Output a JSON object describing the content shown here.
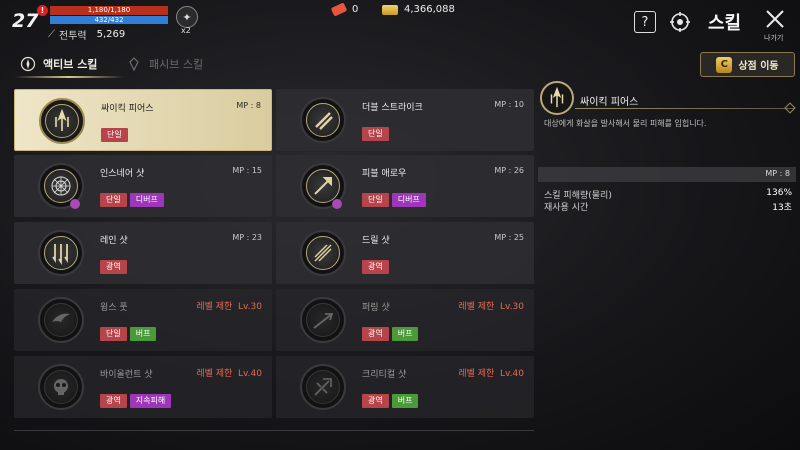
{
  "player": {
    "level": "27",
    "hp_text": "1,180/1,180",
    "mp_text": "432/432",
    "power_label": "전투력",
    "power_value": "5,269",
    "buff_count": "x2"
  },
  "currency": {
    "gems": "0",
    "gold": "4,366,088"
  },
  "header": {
    "title": "스킬",
    "exit_label": "나가기"
  },
  "tabs": {
    "active": "액티브 스킬",
    "passive": "패시브 스킬"
  },
  "shop_button": "상점 이동",
  "skills": [
    {
      "name": "싸이킥 피어스",
      "mp": "MP : 8",
      "tags": [
        "단일"
      ],
      "icon": "psychic-pierce-icon"
    },
    {
      "name": "더블 스트라이크",
      "mp": "MP : 10",
      "tags": [
        "단일"
      ],
      "icon": "double-strike-icon"
    },
    {
      "name": "인스네어 샷",
      "mp": "MP : 15",
      "tags": [
        "단일",
        "디버프"
      ],
      "icon": "ensnare-shot-icon"
    },
    {
      "name": "피블 애로우",
      "mp": "MP : 26",
      "tags": [
        "단일",
        "디버프"
      ],
      "icon": "feeble-arrow-icon"
    },
    {
      "name": "레인 샷",
      "mp": "MP : 23",
      "tags": [
        "광역"
      ],
      "icon": "rain-shot-icon"
    },
    {
      "name": "드릴 샷",
      "mp": "MP : 25",
      "tags": [
        "광역"
      ],
      "icon": "drill-shot-icon"
    },
    {
      "name": "윙스 풋",
      "req_label": "레벨 제한",
      "req_level": "Lv.30",
      "tags": [
        "단일",
        "버프"
      ],
      "icon": "wings-foot-icon"
    },
    {
      "name": "퍼링 샷",
      "req_label": "레벨 제한",
      "req_level": "Lv.30",
      "tags": [
        "광역",
        "버프"
      ],
      "icon": "piercing-shot-icon"
    },
    {
      "name": "바이올런트 샷",
      "req_label": "레벨 제한",
      "req_level": "Lv.40",
      "tags": [
        "광역",
        "지속피해"
      ],
      "icon": "violent-shot-icon"
    },
    {
      "name": "크리티컬 샷",
      "req_label": "레벨 제한",
      "req_level": "Lv.40",
      "tags": [
        "광역",
        "버프"
      ],
      "icon": "critical-shot-icon"
    }
  ],
  "detail": {
    "name": "싸이킥 피어스",
    "description": "대상에게 화살을 발사해서 물리 피해를 입힙니다.",
    "mp": "MP : 8",
    "stats": [
      {
        "label": "스킬 피해량(물리)",
        "value": "136%"
      },
      {
        "label": "재사용 시간",
        "value": "13초"
      }
    ]
  },
  "colors": {
    "tag_red": "#b5454a",
    "tag_purple": "#9d36b8",
    "tag_green": "#4a9a3a",
    "level_req": "#e8684f"
  }
}
